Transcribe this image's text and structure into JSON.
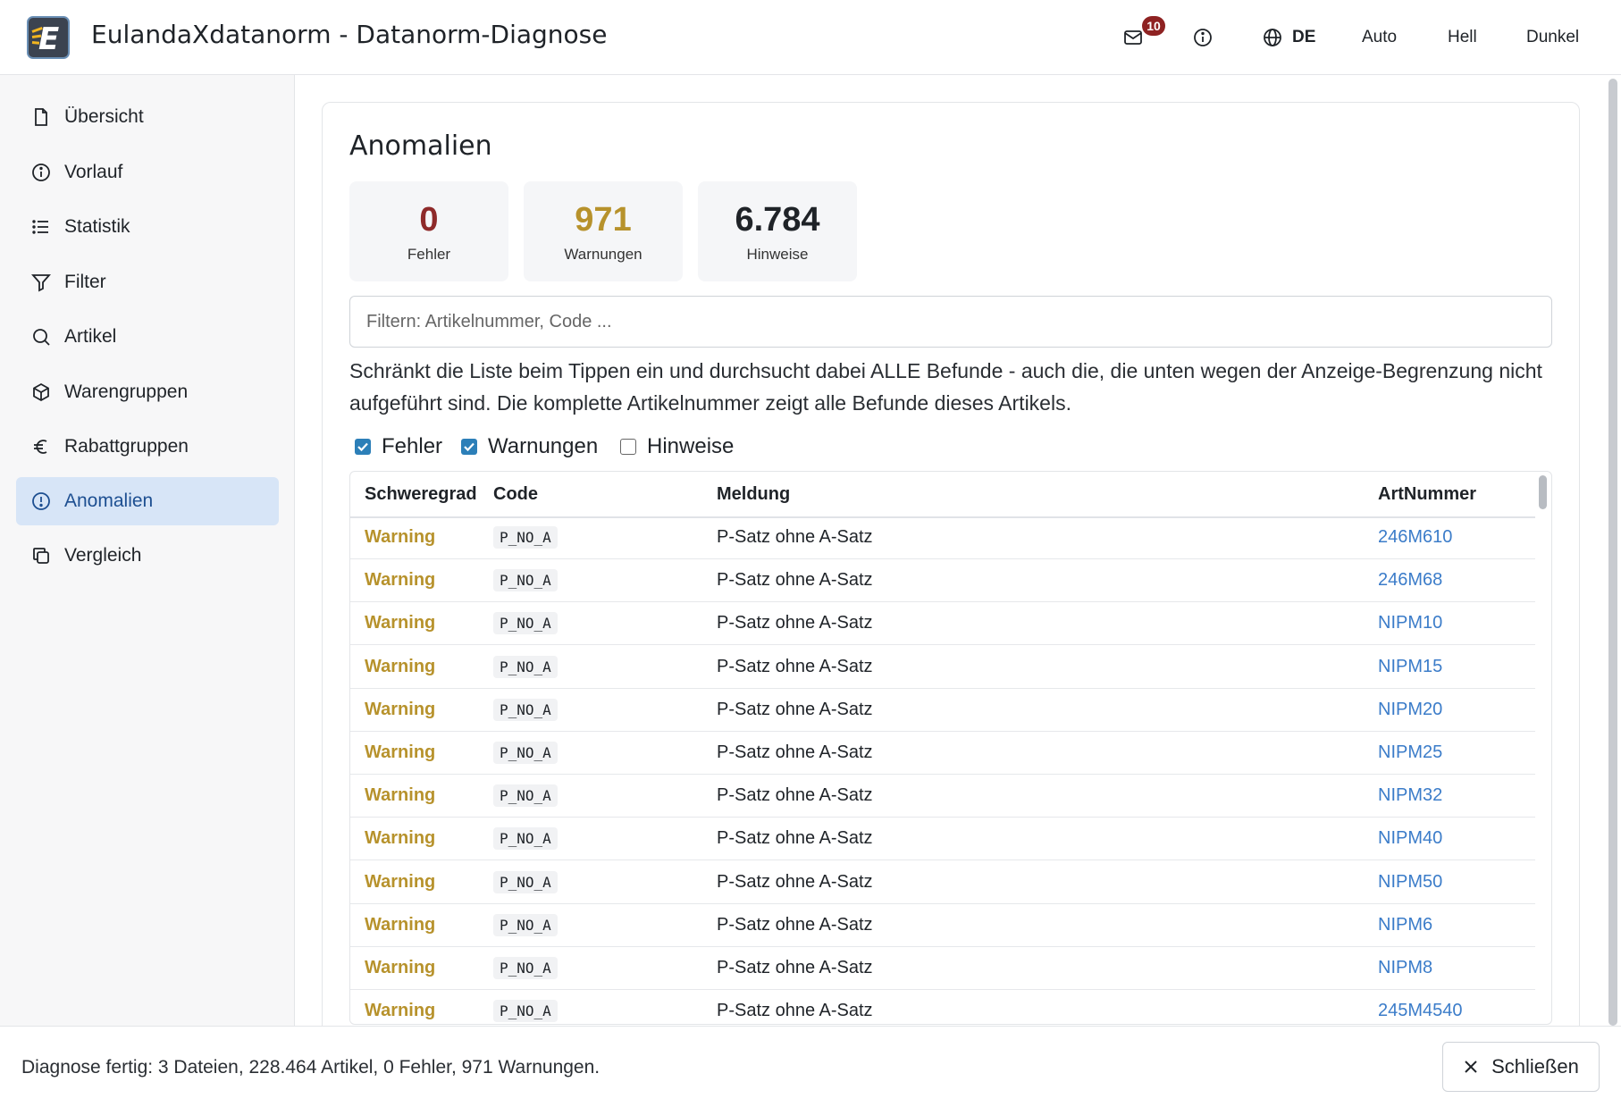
{
  "header": {
    "title": "EulandaXdatanorm - Datanorm-Diagnose",
    "mail_badge": "10",
    "language": "DE",
    "theme_auto": "Auto",
    "theme_light": "Hell",
    "theme_dark": "Dunkel"
  },
  "sidebar": {
    "items": [
      {
        "label": "Übersicht",
        "icon": "file-icon"
      },
      {
        "label": "Vorlauf",
        "icon": "info-icon"
      },
      {
        "label": "Statistik",
        "icon": "list-icon"
      },
      {
        "label": "Filter",
        "icon": "filter-icon"
      },
      {
        "label": "Artikel",
        "icon": "search-icon"
      },
      {
        "label": "Warengruppen",
        "icon": "box-icon"
      },
      {
        "label": "Rabattgruppen",
        "icon": "euro-icon"
      },
      {
        "label": "Anomalien",
        "icon": "alert-circle-icon",
        "active": true
      },
      {
        "label": "Vergleich",
        "icon": "copy-icon"
      }
    ]
  },
  "main": {
    "title": "Anomalien",
    "stats": [
      {
        "value": "0",
        "label": "Fehler",
        "color": "#8e2a2a"
      },
      {
        "value": "971",
        "label": "Warnungen",
        "color": "#b7922c"
      },
      {
        "value": "6.784",
        "label": "Hinweise",
        "color": "#1f2328"
      }
    ],
    "filter_placeholder": "Filtern: Artikelnummer, Code ...",
    "help_text": "Schränkt die Liste beim Tippen ein und durchsucht dabei ALLE Befunde - auch die, die unten wegen der Anzeige-Begrenzung nicht aufgeführt sind. Die komplette Artikelnummer zeigt alle Befunde dieses Artikels.",
    "checkboxes": [
      {
        "label": "Fehler",
        "checked": true
      },
      {
        "label": "Warnungen",
        "checked": true
      },
      {
        "label": "Hinweise",
        "checked": false
      }
    ],
    "table": {
      "columns": [
        "Schweregrad",
        "Code",
        "Meldung",
        "ArtNummer"
      ],
      "rows": [
        {
          "severity": "Warning",
          "code": "P_NO_A",
          "message": "P-Satz ohne A-Satz",
          "art": "246M610"
        },
        {
          "severity": "Warning",
          "code": "P_NO_A",
          "message": "P-Satz ohne A-Satz",
          "art": "246M68"
        },
        {
          "severity": "Warning",
          "code": "P_NO_A",
          "message": "P-Satz ohne A-Satz",
          "art": "NIPM10"
        },
        {
          "severity": "Warning",
          "code": "P_NO_A",
          "message": "P-Satz ohne A-Satz",
          "art": "NIPM15"
        },
        {
          "severity": "Warning",
          "code": "P_NO_A",
          "message": "P-Satz ohne A-Satz",
          "art": "NIPM20"
        },
        {
          "severity": "Warning",
          "code": "P_NO_A",
          "message": "P-Satz ohne A-Satz",
          "art": "NIPM25"
        },
        {
          "severity": "Warning",
          "code": "P_NO_A",
          "message": "P-Satz ohne A-Satz",
          "art": "NIPM32"
        },
        {
          "severity": "Warning",
          "code": "P_NO_A",
          "message": "P-Satz ohne A-Satz",
          "art": "NIPM40"
        },
        {
          "severity": "Warning",
          "code": "P_NO_A",
          "message": "P-Satz ohne A-Satz",
          "art": "NIPM50"
        },
        {
          "severity": "Warning",
          "code": "P_NO_A",
          "message": "P-Satz ohne A-Satz",
          "art": "NIPM6"
        },
        {
          "severity": "Warning",
          "code": "P_NO_A",
          "message": "P-Satz ohne A-Satz",
          "art": "NIPM8"
        },
        {
          "severity": "Warning",
          "code": "P_NO_A",
          "message": "P-Satz ohne A-Satz",
          "art": "245M4540"
        }
      ]
    }
  },
  "footer": {
    "status": "Diagnose fertig: 3 Dateien, 228.464 Artikel, 0 Fehler, 971 Warnungen.",
    "close_label": "Schließen"
  },
  "colors": {
    "accent": "#2c7fb8",
    "active_nav_bg": "#d7e5f7",
    "warning": "#b7922c",
    "error": "#8e2a2a",
    "link": "#3b7cc9"
  }
}
